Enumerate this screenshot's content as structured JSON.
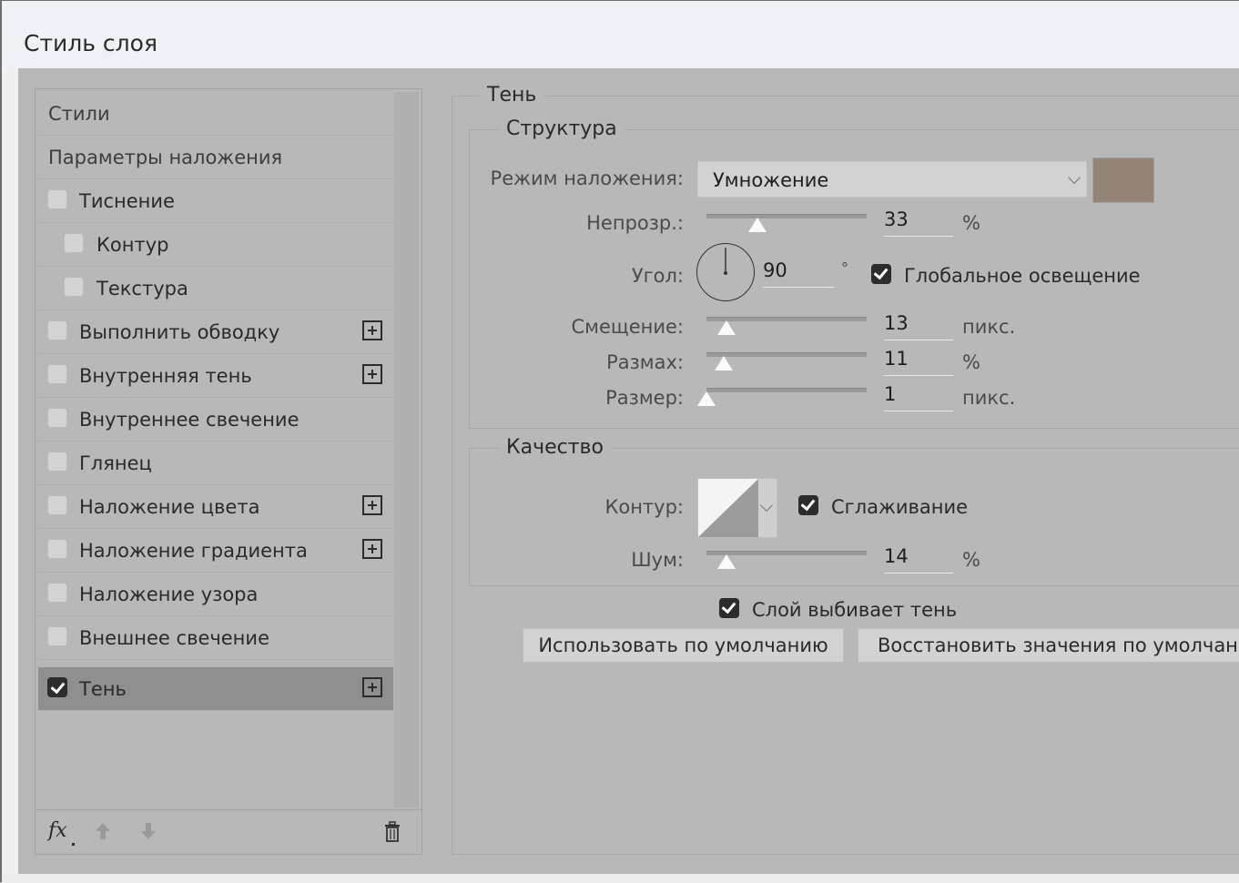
{
  "window": {
    "title": "Стиль слоя"
  },
  "styles_list": {
    "items": [
      {
        "label": "Стили",
        "type": "plain"
      },
      {
        "label": "Параметры наложения",
        "type": "plain"
      },
      {
        "label": "Тиснение",
        "type": "check",
        "checked": false,
        "indent": false,
        "plus": false
      },
      {
        "label": "Контур",
        "type": "check",
        "checked": false,
        "indent": true,
        "plus": false
      },
      {
        "label": "Текстура",
        "type": "check",
        "checked": false,
        "indent": true,
        "plus": false
      },
      {
        "label": "Выполнить обводку",
        "type": "check",
        "checked": false,
        "indent": false,
        "plus": true
      },
      {
        "label": "Внутренняя тень",
        "type": "check",
        "checked": false,
        "indent": false,
        "plus": true
      },
      {
        "label": "Внутреннее свечение",
        "type": "check",
        "checked": false,
        "indent": false,
        "plus": false
      },
      {
        "label": "Глянец",
        "type": "check",
        "checked": false,
        "indent": false,
        "plus": false
      },
      {
        "label": "Наложение цвета",
        "type": "check",
        "checked": false,
        "indent": false,
        "plus": true
      },
      {
        "label": "Наложение градиента",
        "type": "check",
        "checked": false,
        "indent": false,
        "plus": true
      },
      {
        "label": "Наложение узора",
        "type": "check",
        "checked": false,
        "indent": false,
        "plus": false
      },
      {
        "label": "Внешнее свечение",
        "type": "check",
        "checked": false,
        "indent": false,
        "plus": false
      },
      {
        "label": "Тень",
        "type": "check",
        "checked": true,
        "indent": false,
        "plus": true,
        "selected": true
      }
    ],
    "toolbar": {
      "fx_label": "fx",
      "icons": [
        "fx-icon",
        "arrow-up-icon",
        "arrow-down-icon",
        "trash-icon"
      ]
    }
  },
  "shadow": {
    "section_title": "Тень",
    "structure": {
      "title": "Структура",
      "blend_mode_label": "Режим наложения:",
      "blend_mode_value": "Умножение",
      "color": "#938477",
      "opacity_label": "Непрозр.:",
      "opacity_value": "33",
      "opacity_fraction": 0.33,
      "opacity_unit": "%",
      "angle_label": "Угол:",
      "angle_value": "90",
      "angle_unit": "°",
      "global_light_label": "Глобальное освещение",
      "global_light_checked": true,
      "distance_label": "Смещение:",
      "distance_value": "13",
      "distance_unit": "пикс.",
      "spread_label": "Размах:",
      "spread_value": "11",
      "spread_unit": "%",
      "size_label": "Размер:",
      "size_value": "1",
      "size_unit": "пикс."
    },
    "quality": {
      "title": "Качество",
      "contour_label": "Контур:",
      "antialias_label": "Сглаживание",
      "antialias_checked": true,
      "noise_label": "Шум:",
      "noise_value": "14",
      "noise_unit": "%"
    },
    "knockout_label": "Слой выбивает тень",
    "knockout_checked": true,
    "make_default_label": "Использовать по умолчанию",
    "reset_default_label": "Восстановить значения по умолчанию"
  }
}
